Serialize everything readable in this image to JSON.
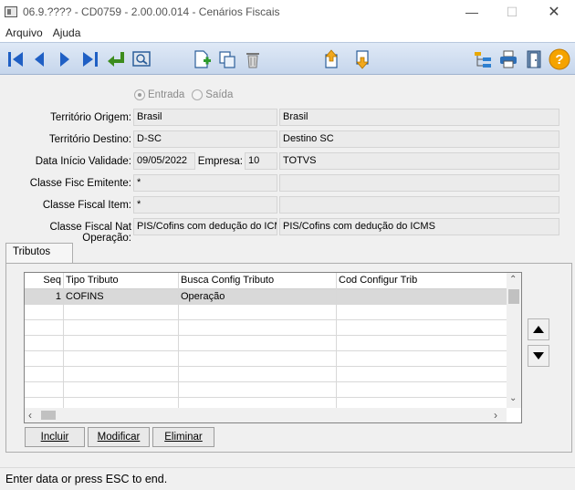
{
  "window": {
    "title": "06.9.???? - CD0759 - 2.00.00.014 - Cenários Fiscais"
  },
  "menu": {
    "items": [
      "Arquivo",
      "Ajuda"
    ]
  },
  "toolbar": {
    "icons": [
      "first-record-icon",
      "previous-record-icon",
      "next-record-icon",
      "last-record-icon",
      "goto-icon",
      "search-icon",
      "new-record-icon",
      "copy-record-icon",
      "delete-record-icon",
      "import-icon",
      "export-icon",
      "tree-icon",
      "print-icon",
      "exit-icon",
      "help-icon"
    ]
  },
  "form": {
    "radio_entrada": "Entrada",
    "radio_saida": "Saída",
    "territorio_origem_label": "Território Origem:",
    "territorio_origem_code": "Brasil",
    "territorio_origem_desc": "Brasil",
    "territorio_destino_label": "Território Destino:",
    "territorio_destino_code": "D-SC",
    "territorio_destino_desc": "Destino SC",
    "data_inicio_label": "Data Início Validade:",
    "data_inicio_value": "09/05/2022",
    "empresa_label": "Empresa:",
    "empresa_code": "10",
    "empresa_desc": "TOTVS",
    "classe_emitente_label": "Classe Fisc Emitente:",
    "classe_emitente_value": "*",
    "classe_item_label": "Classe Fiscal Item:",
    "classe_item_value": "*",
    "classe_nat_label": "Classe Fiscal Nat Operação:",
    "classe_nat_code": "PIS/Cofins com dedução do ICM",
    "classe_nat_desc": "PIS/Cofins com dedução do ICMS"
  },
  "tabs": {
    "tributos": "Tributos"
  },
  "grid": {
    "headers": {
      "seq": "Seq",
      "tipo": "Tipo Tributo",
      "busca": "Busca Config Tributo",
      "cod": "Cod Configur Trib"
    },
    "rows": [
      {
        "seq": "1",
        "tipo": "COFINS",
        "busca": "Operação",
        "cod": ""
      }
    ]
  },
  "buttons": {
    "incluir": "Incluir",
    "modificar": "Modificar",
    "eliminar": "Eliminar"
  },
  "status": {
    "text": "Enter data or press ESC to end."
  }
}
